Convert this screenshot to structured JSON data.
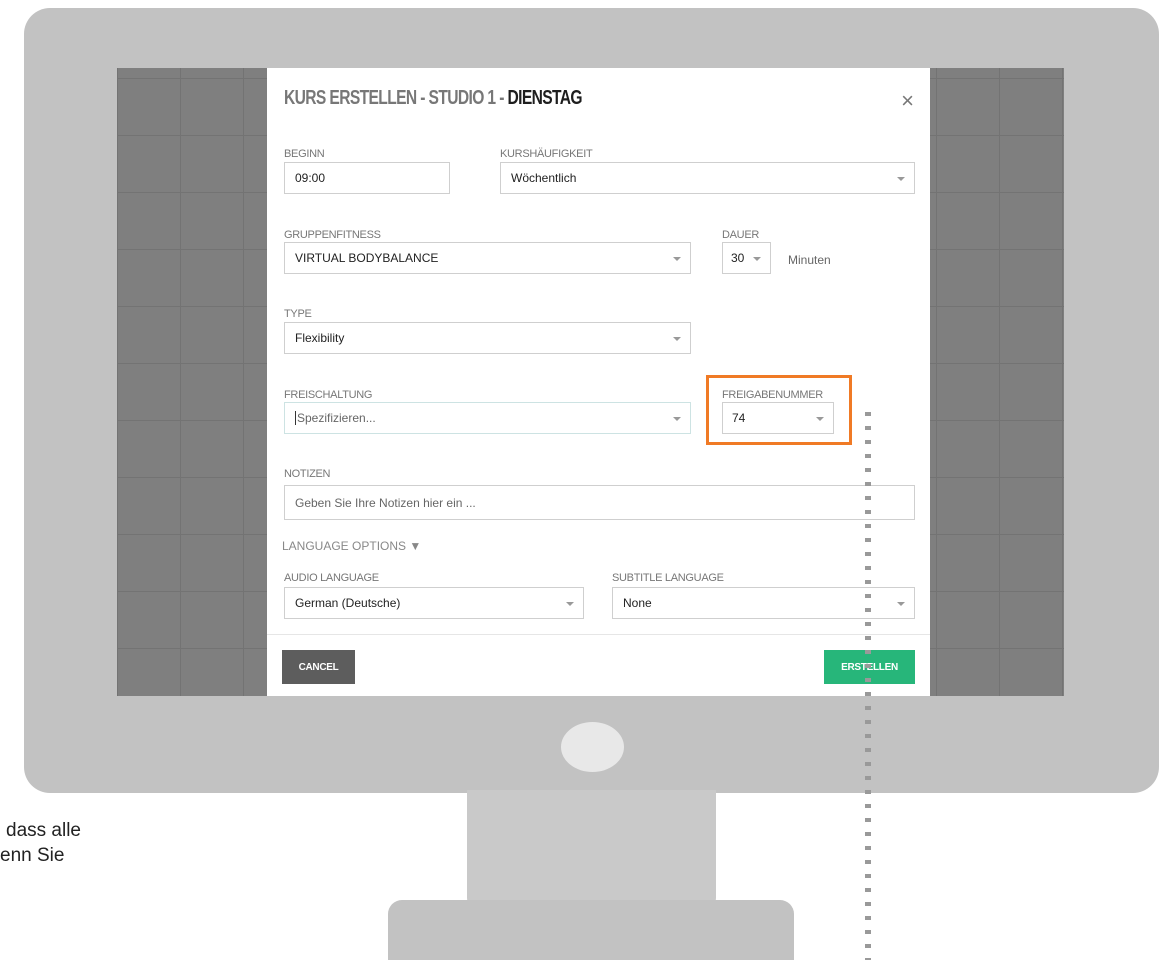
{
  "dialog": {
    "title_prefix": "KURS ERSTELLEN - STUDIO 1 -",
    "title_day": "DIENSTAG",
    "close_symbol": "×"
  },
  "fields": {
    "beginn": {
      "label": "BEGINN",
      "value": "09:00"
    },
    "kurshaeufigkeit": {
      "label": "KURSHÄUFIGKEIT",
      "value": "Wöchentlich"
    },
    "gruppenfitness": {
      "label": "GRUPPENFITNESS",
      "value": "VIRTUAL BODYBALANCE"
    },
    "dauer": {
      "label": "DAUER",
      "value": "30",
      "unit": "Minuten"
    },
    "type": {
      "label": "TYPE",
      "value": "Flexibility"
    },
    "freischaltung": {
      "label": "FREISCHALTUNG",
      "placeholder": "Spezifizieren..."
    },
    "freigabenummer": {
      "label": "FREIGABENUMMER",
      "value": "74"
    },
    "notizen": {
      "label": "NOTIZEN",
      "placeholder": "Geben Sie Ihre Notizen hier ein ..."
    },
    "audio_language": {
      "label": "AUDIO LANGUAGE",
      "value": "German (Deutsche)"
    },
    "subtitle_language": {
      "label": "SUBTITLE LANGUAGE",
      "value": "None"
    }
  },
  "language_options_label": "LANGUAGE OPTIONS ▼",
  "buttons": {
    "cancel": "CANCEL",
    "create": "ERSTELLEN"
  },
  "side_text": {
    "line1": "dass alle",
    "line2": "enn Sie"
  },
  "colors": {
    "highlight": "#f07a25",
    "create_button": "#27b67a",
    "cancel_button": "#5d5d5d"
  }
}
